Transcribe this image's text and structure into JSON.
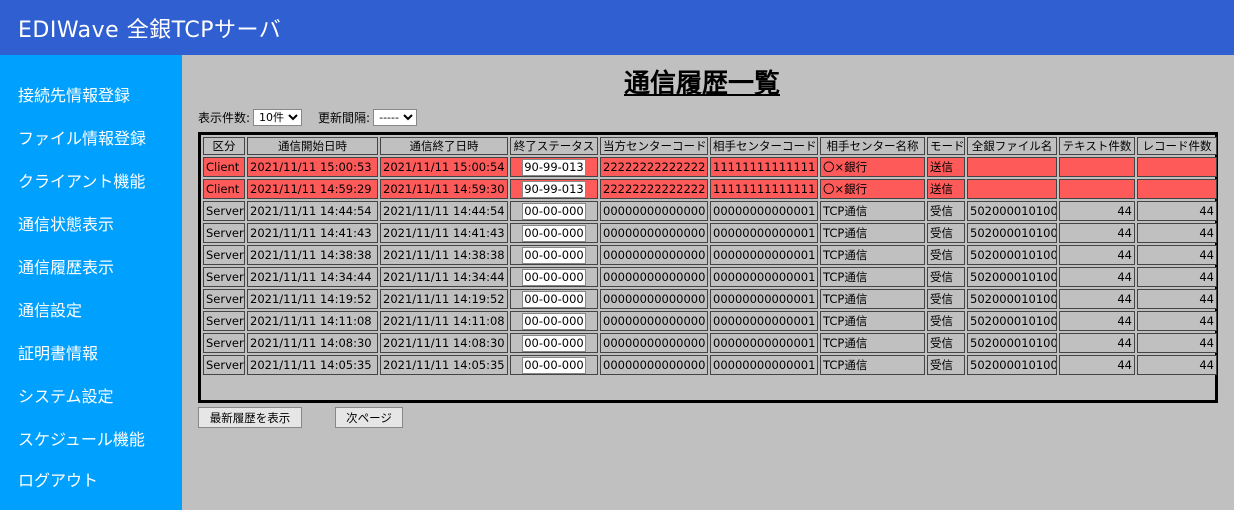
{
  "app": {
    "title": "EDIWave 全銀TCPサーバ"
  },
  "sidebar": {
    "items": [
      {
        "label": "接続先情報登録"
      },
      {
        "label": "ファイル情報登録"
      },
      {
        "label": "クライアント機能"
      },
      {
        "label": "通信状態表示"
      },
      {
        "label": "通信履歴表示"
      },
      {
        "label": "通信設定"
      },
      {
        "label": "証明書情報"
      },
      {
        "label": "システム設定"
      },
      {
        "label": "スケジュール機能"
      },
      {
        "label": "ログアウト"
      }
    ]
  },
  "page": {
    "title": "通信履歴一覧"
  },
  "controls": {
    "display_count_label": "表示件数:",
    "display_count_value": "10件",
    "update_interval_label": "更新間隔:",
    "update_interval_value": "-----"
  },
  "table": {
    "headers": [
      "区分",
      "通信開始日時",
      "通信終了日時",
      "終了ステータス",
      "当方センターコード",
      "相手センターコード",
      "相手センター名称",
      "モード",
      "全銀ファイル名",
      "テキスト件数",
      "レコード件数"
    ],
    "rows": [
      {
        "kind": "Client",
        "start": "2021/11/11 15:00:53",
        "end": "2021/11/11 15:00:54",
        "status": "90-99-013",
        "own": "22222222222222",
        "partner": "11111111111111",
        "name": "〇×銀行",
        "mode": "送信",
        "file": "",
        "text": "",
        "record": ""
      },
      {
        "kind": "Client",
        "start": "2021/11/11 14:59:29",
        "end": "2021/11/11 14:59:30",
        "status": "90-99-013",
        "own": "22222222222222",
        "partner": "11111111111111",
        "name": "〇×銀行",
        "mode": "送信",
        "file": "",
        "text": "",
        "record": ""
      },
      {
        "kind": "Server",
        "start": "2021/11/11 14:44:54",
        "end": "2021/11/11 14:44:54",
        "status": "00-00-000",
        "own": "00000000000000",
        "partner": "00000000000001",
        "name": "TCP通信",
        "mode": "受信",
        "file": "502000010100",
        "text": "44",
        "record": "44"
      },
      {
        "kind": "Server",
        "start": "2021/11/11 14:41:43",
        "end": "2021/11/11 14:41:43",
        "status": "00-00-000",
        "own": "00000000000000",
        "partner": "00000000000001",
        "name": "TCP通信",
        "mode": "受信",
        "file": "502000010100",
        "text": "44",
        "record": "44"
      },
      {
        "kind": "Server",
        "start": "2021/11/11 14:38:38",
        "end": "2021/11/11 14:38:38",
        "status": "00-00-000",
        "own": "00000000000000",
        "partner": "00000000000001",
        "name": "TCP通信",
        "mode": "受信",
        "file": "502000010100",
        "text": "44",
        "record": "44"
      },
      {
        "kind": "Server",
        "start": "2021/11/11 14:34:44",
        "end": "2021/11/11 14:34:44",
        "status": "00-00-000",
        "own": "00000000000000",
        "partner": "00000000000001",
        "name": "TCP通信",
        "mode": "受信",
        "file": "502000010100",
        "text": "44",
        "record": "44"
      },
      {
        "kind": "Server",
        "start": "2021/11/11 14:19:52",
        "end": "2021/11/11 14:19:52",
        "status": "00-00-000",
        "own": "00000000000000",
        "partner": "00000000000001",
        "name": "TCP通信",
        "mode": "受信",
        "file": "502000010100",
        "text": "44",
        "record": "44"
      },
      {
        "kind": "Server",
        "start": "2021/11/11 14:11:08",
        "end": "2021/11/11 14:11:08",
        "status": "00-00-000",
        "own": "00000000000000",
        "partner": "00000000000001",
        "name": "TCP通信",
        "mode": "受信",
        "file": "502000010100",
        "text": "44",
        "record": "44"
      },
      {
        "kind": "Server",
        "start": "2021/11/11 14:08:30",
        "end": "2021/11/11 14:08:30",
        "status": "00-00-000",
        "own": "00000000000000",
        "partner": "00000000000001",
        "name": "TCP通信",
        "mode": "受信",
        "file": "502000010100",
        "text": "44",
        "record": "44"
      },
      {
        "kind": "Server",
        "start": "2021/11/11 14:05:35",
        "end": "2021/11/11 14:05:35",
        "status": "00-00-000",
        "own": "00000000000000",
        "partner": "00000000000001",
        "name": "TCP通信",
        "mode": "受信",
        "file": "502000010100",
        "text": "44",
        "record": "44"
      }
    ]
  },
  "buttons": {
    "latest_label": "最新履歴を表示",
    "next_label": "次ページ"
  },
  "colors": {
    "header_bg": "#2f5fd0",
    "sidebar_bg": "#00a0ff",
    "content_bg": "#c0c0c0",
    "client_row": "#ff5a5a"
  }
}
